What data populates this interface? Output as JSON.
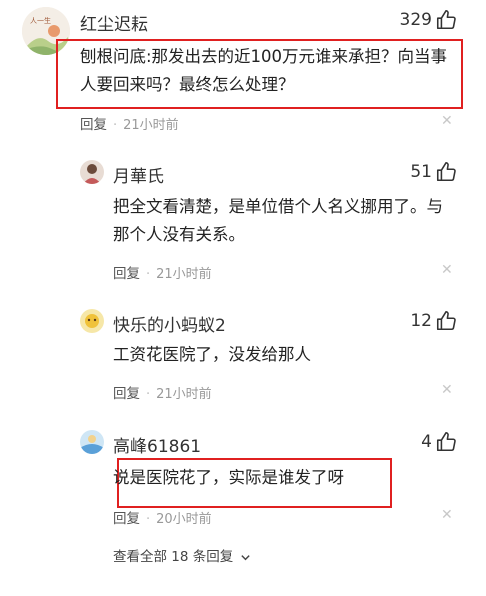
{
  "top_comment": {
    "author": "红尘迟耘",
    "likes": "329",
    "text": "刨根问底:那发出去的近100万元谁来承担？向当事人要回来吗？最终怎么处理？",
    "reply_label": "回复",
    "time": "21小时前"
  },
  "replies": [
    {
      "author": "月華氏",
      "likes": "51",
      "text": "把全文看清楚，是单位借个人名义挪用了。与那个人没有关系。",
      "reply_label": "回复",
      "time": "21小时前"
    },
    {
      "author": "快乐的小蚂蚁2",
      "likes": "12",
      "text": "工资花医院了，没发给那人",
      "reply_label": "回复",
      "time": "21小时前"
    },
    {
      "author": "高峰61861",
      "likes": "4",
      "text": "说是医院花了，实际是谁发了呀",
      "reply_label": "回复",
      "time": "20小时前"
    }
  ],
  "view_all": "查看全部 18 条回复",
  "colors": {
    "highlight_border": "#e02020",
    "meta_gray": "#999999"
  }
}
